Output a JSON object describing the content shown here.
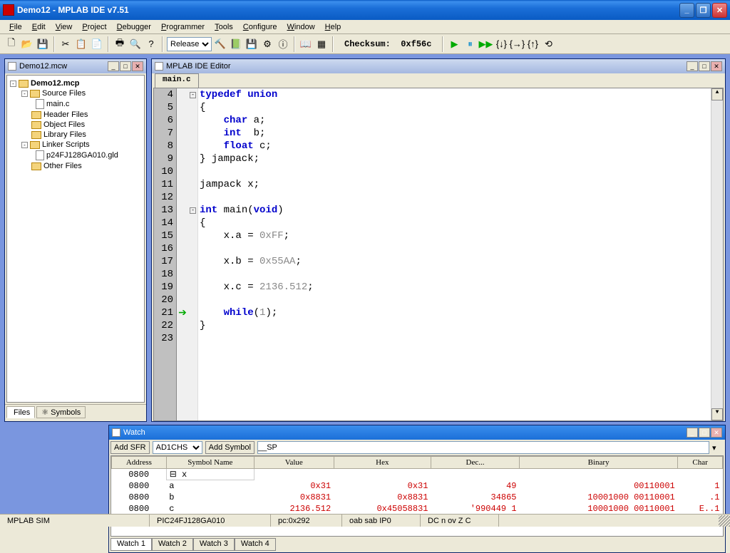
{
  "window": {
    "title": "Demo12 - MPLAB IDE v7.51"
  },
  "menus": [
    "File",
    "Edit",
    "View",
    "Project",
    "Debugger",
    "Programmer",
    "Tools",
    "Configure",
    "Window",
    "Help"
  ],
  "toolbar": {
    "config_label": "Release",
    "checksum_label": "Checksum:",
    "checksum_value": "0xf56c"
  },
  "project_window": {
    "title": "Demo12.mcw",
    "root": "Demo12.mcp",
    "folders": [
      {
        "name": "Source Files",
        "children": [
          "main.c"
        ]
      },
      {
        "name": "Header Files",
        "children": []
      },
      {
        "name": "Object Files",
        "children": []
      },
      {
        "name": "Library Files",
        "children": []
      },
      {
        "name": "Linker Scripts",
        "children": [
          "p24FJ128GA010.gld"
        ]
      },
      {
        "name": "Other Files",
        "children": []
      }
    ],
    "tabs": [
      "Files",
      "Symbols"
    ]
  },
  "editor_window": {
    "title": "MPLAB IDE Editor",
    "active_tab": "main.c",
    "first_line": 4,
    "exec_line": 21,
    "lines": [
      {
        "n": 4,
        "fold": "-",
        "html": "<span class='kw'>typedef</span> <span class='kw'>union</span>"
      },
      {
        "n": 5,
        "html": "{"
      },
      {
        "n": 6,
        "html": "    <span class='kw'>char</span> a;"
      },
      {
        "n": 7,
        "html": "    <span class='kw'>int</span>  b;"
      },
      {
        "n": 8,
        "html": "    <span class='kw'>float</span> c;"
      },
      {
        "n": 9,
        "html": "} jampack;"
      },
      {
        "n": 10,
        "html": ""
      },
      {
        "n": 11,
        "html": "jampack x;"
      },
      {
        "n": 12,
        "html": ""
      },
      {
        "n": 13,
        "fold": "-",
        "html": "<span class='kw'>int</span> main(<span class='kw'>void</span>)"
      },
      {
        "n": 14,
        "html": "{"
      },
      {
        "n": 15,
        "html": "    x.a = <span class='num'>0xFF</span>;"
      },
      {
        "n": 16,
        "html": ""
      },
      {
        "n": 17,
        "html": "    x.b = <span class='num'>0x55AA</span>;"
      },
      {
        "n": 18,
        "html": ""
      },
      {
        "n": 19,
        "html": "    x.c = <span class='num'>2136.512</span>;"
      },
      {
        "n": 20,
        "html": ""
      },
      {
        "n": 21,
        "html": "    <span class='kw'>while</span>(<span class='num'>1</span>);"
      },
      {
        "n": 22,
        "html": "}"
      },
      {
        "n": 23,
        "html": ""
      }
    ]
  },
  "watch_window": {
    "title": "Watch",
    "add_sfr_label": "Add SFR",
    "sfr_value": "AD1CHS",
    "add_symbol_label": "Add Symbol",
    "symbol_value": "__SP",
    "columns": [
      "Address",
      "Symbol Name",
      "Value",
      "Hex",
      "Dec...",
      "Binary",
      "Char"
    ],
    "rows": [
      {
        "root": true,
        "addr": "0800",
        "sym": "⊟ x",
        "val": "",
        "hex": "",
        "dec": "",
        "bin": "",
        "char": ""
      },
      {
        "addr": "0800",
        "sym": "    a",
        "val": "0x31",
        "hex": "0x31",
        "dec": "49",
        "bin": "00110001",
        "char": "1"
      },
      {
        "addr": "0800",
        "sym": "    b",
        "val": "0x8831",
        "hex": "0x8831",
        "dec": "34865",
        "bin": "10001000 00110001",
        "char": ".1"
      },
      {
        "addr": "0800",
        "sym": "    c",
        "val": "2136.512",
        "hex": "0x45058831",
        "dec": "'990449 1",
        "bin": "10001000 00110001",
        "char": "E..1"
      }
    ],
    "tabs": [
      "Watch 1",
      "Watch 2",
      "Watch 3",
      "Watch 4"
    ]
  },
  "statusbar": {
    "sim": "MPLAB SIM",
    "device": "PIC24FJ128GA010",
    "pc": "pc:0x292",
    "bank": "oab sab IP0",
    "flags": "DC n ov Z C"
  }
}
